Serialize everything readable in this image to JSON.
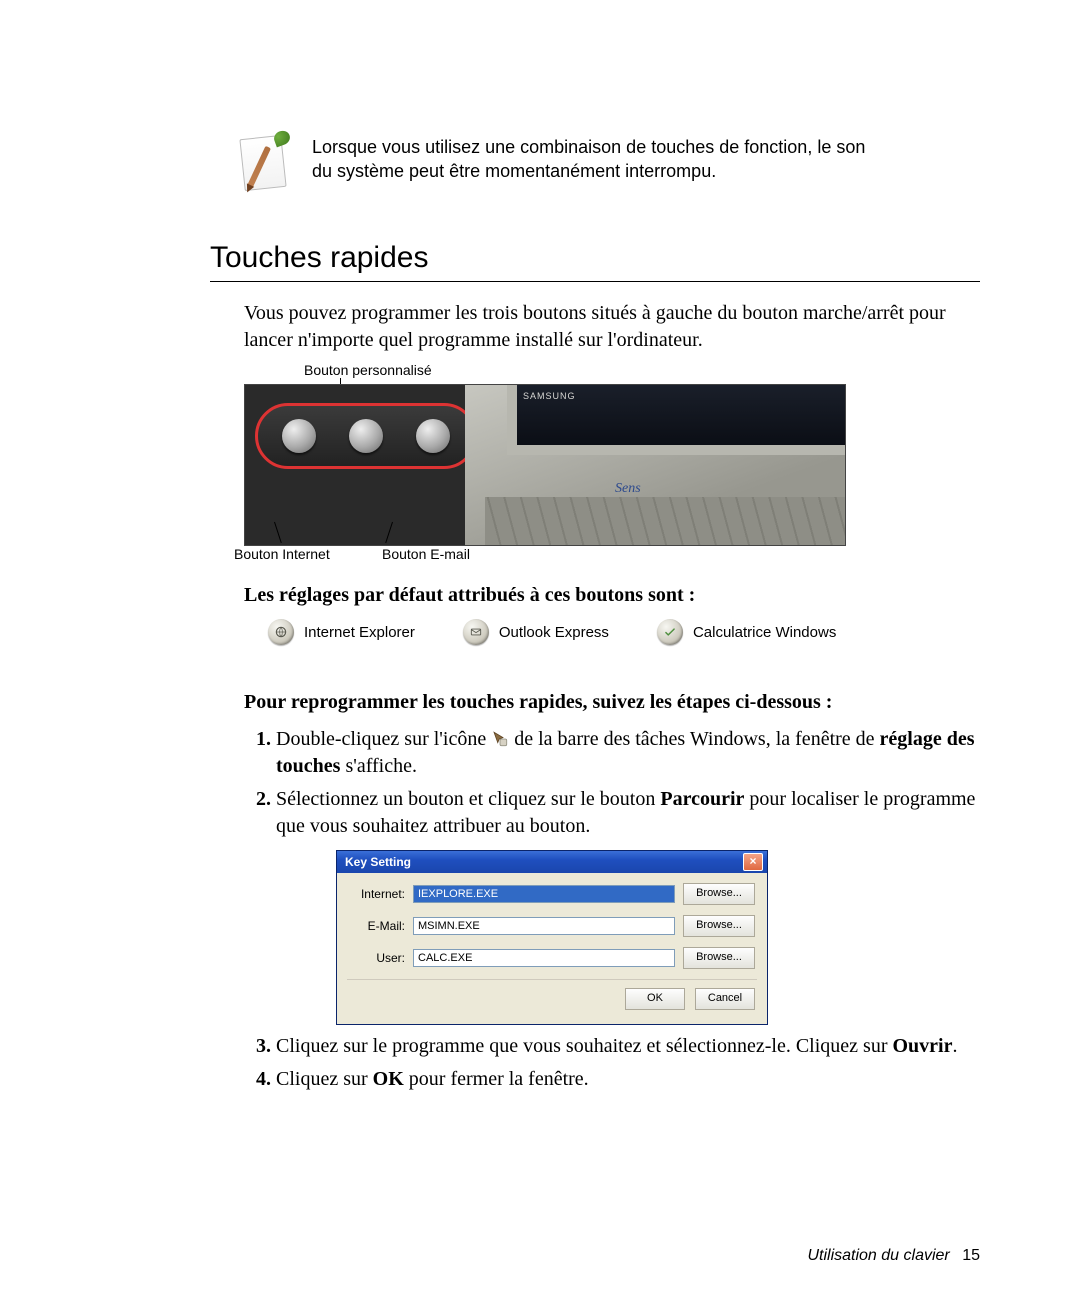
{
  "note": {
    "text": "Lorsque vous utilisez une combinaison de touches de fonction, le son du système peut être momentanément interrompu."
  },
  "section_title": "Touches rapides",
  "intro": "Vous pouvez programmer les trois boutons situés à gauche du bouton marche/arrêt pour lancer n'importe quel programme installé sur l'ordinateur.",
  "figure": {
    "callout_top": "Bouton personnalisé",
    "callout_b1": "Bouton Internet",
    "callout_b2": "Bouton E-mail",
    "brand": "SAMSUNG",
    "sens": "Sens"
  },
  "defaults_heading": "Les réglages par défaut attribués à ces boutons sont :",
  "defaults": {
    "ie": "Internet Explorer",
    "outlook": "Outlook Express",
    "calc": "Calculatrice Windows"
  },
  "reprogram_heading": "Pour reprogrammer les touches rapides, suivez les étapes ci-dessous :",
  "steps": {
    "s1a": "Double-cliquez sur l'icône ",
    "s1b": " de la barre des tâches Windows, la fenêtre de ",
    "s1c": "réglage des touches",
    "s1d": " s'affiche.",
    "s2a": "Sélectionnez un bouton et cliquez sur le bouton ",
    "s2b": "Parcourir",
    "s2c": " pour localiser le programme que vous souhaitez attribuer au bouton.",
    "s3a": "Cliquez sur le programme que vous souhaitez et sélectionnez-le. Cliquez sur ",
    "s3b": "Ouvrir",
    "s3c": ".",
    "s4a": "Cliquez sur ",
    "s4b": "OK",
    "s4c": " pour fermer la fenêtre."
  },
  "dialog": {
    "title": "Key Setting",
    "rows": {
      "internet": {
        "label": "Internet:",
        "value": "IEXPLORE.EXE",
        "browse": "Browse..."
      },
      "email": {
        "label": "E-Mail:",
        "value": "MSIMN.EXE",
        "browse": "Browse..."
      },
      "user": {
        "label": "User:",
        "value": "CALC.EXE",
        "browse": "Browse..."
      }
    },
    "ok": "OK",
    "cancel": "Cancel"
  },
  "footer": {
    "text": "Utilisation du clavier",
    "page": "15"
  }
}
